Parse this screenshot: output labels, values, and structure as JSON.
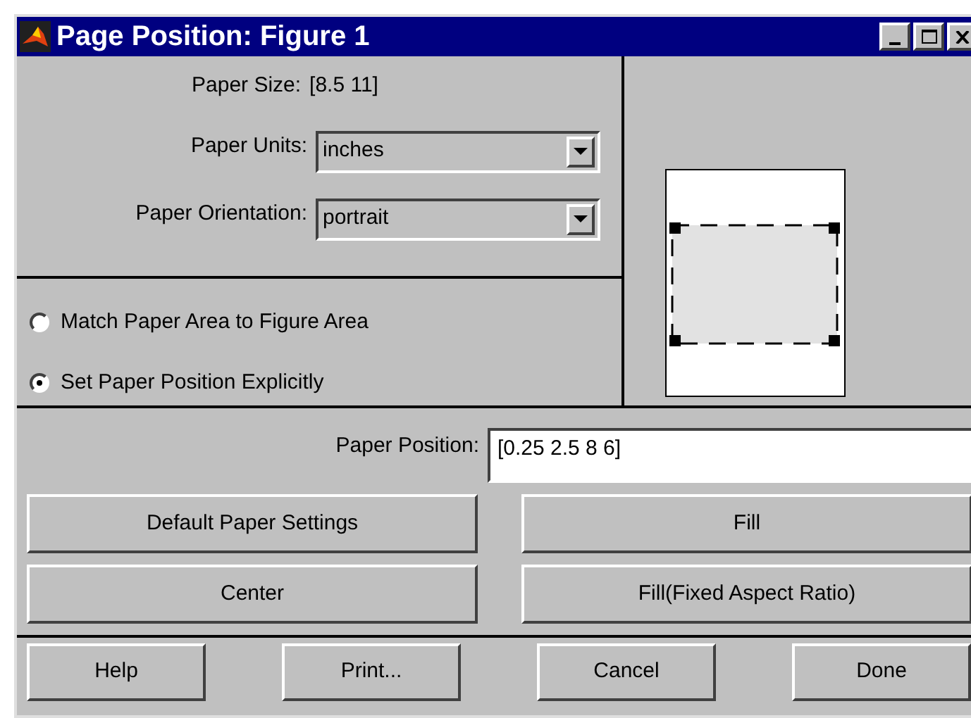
{
  "window": {
    "title": "Page Position: Figure 1"
  },
  "paper_size": {
    "label": "Paper Size:",
    "value": "[8.5 11]"
  },
  "dropdowns": [
    {
      "label": "Paper Units:",
      "value": "inches"
    },
    {
      "label": "Paper Orientation:",
      "value": "portrait"
    }
  ],
  "radios": [
    {
      "label": "Match Paper Area to Figure Area",
      "selected": false
    },
    {
      "label": "Set Paper Position Explicitly",
      "selected": true
    }
  ],
  "paper_position": {
    "label": "Paper Position:",
    "value": "[0.25 2.5 8 6]"
  },
  "action_buttons": [
    [
      "Default Paper Settings",
      "Fill"
    ],
    [
      "Center",
      "Fill(Fixed Aspect Ratio)"
    ]
  ],
  "dialog_buttons": [
    "Help",
    "Print...",
    "Cancel",
    "Done"
  ]
}
